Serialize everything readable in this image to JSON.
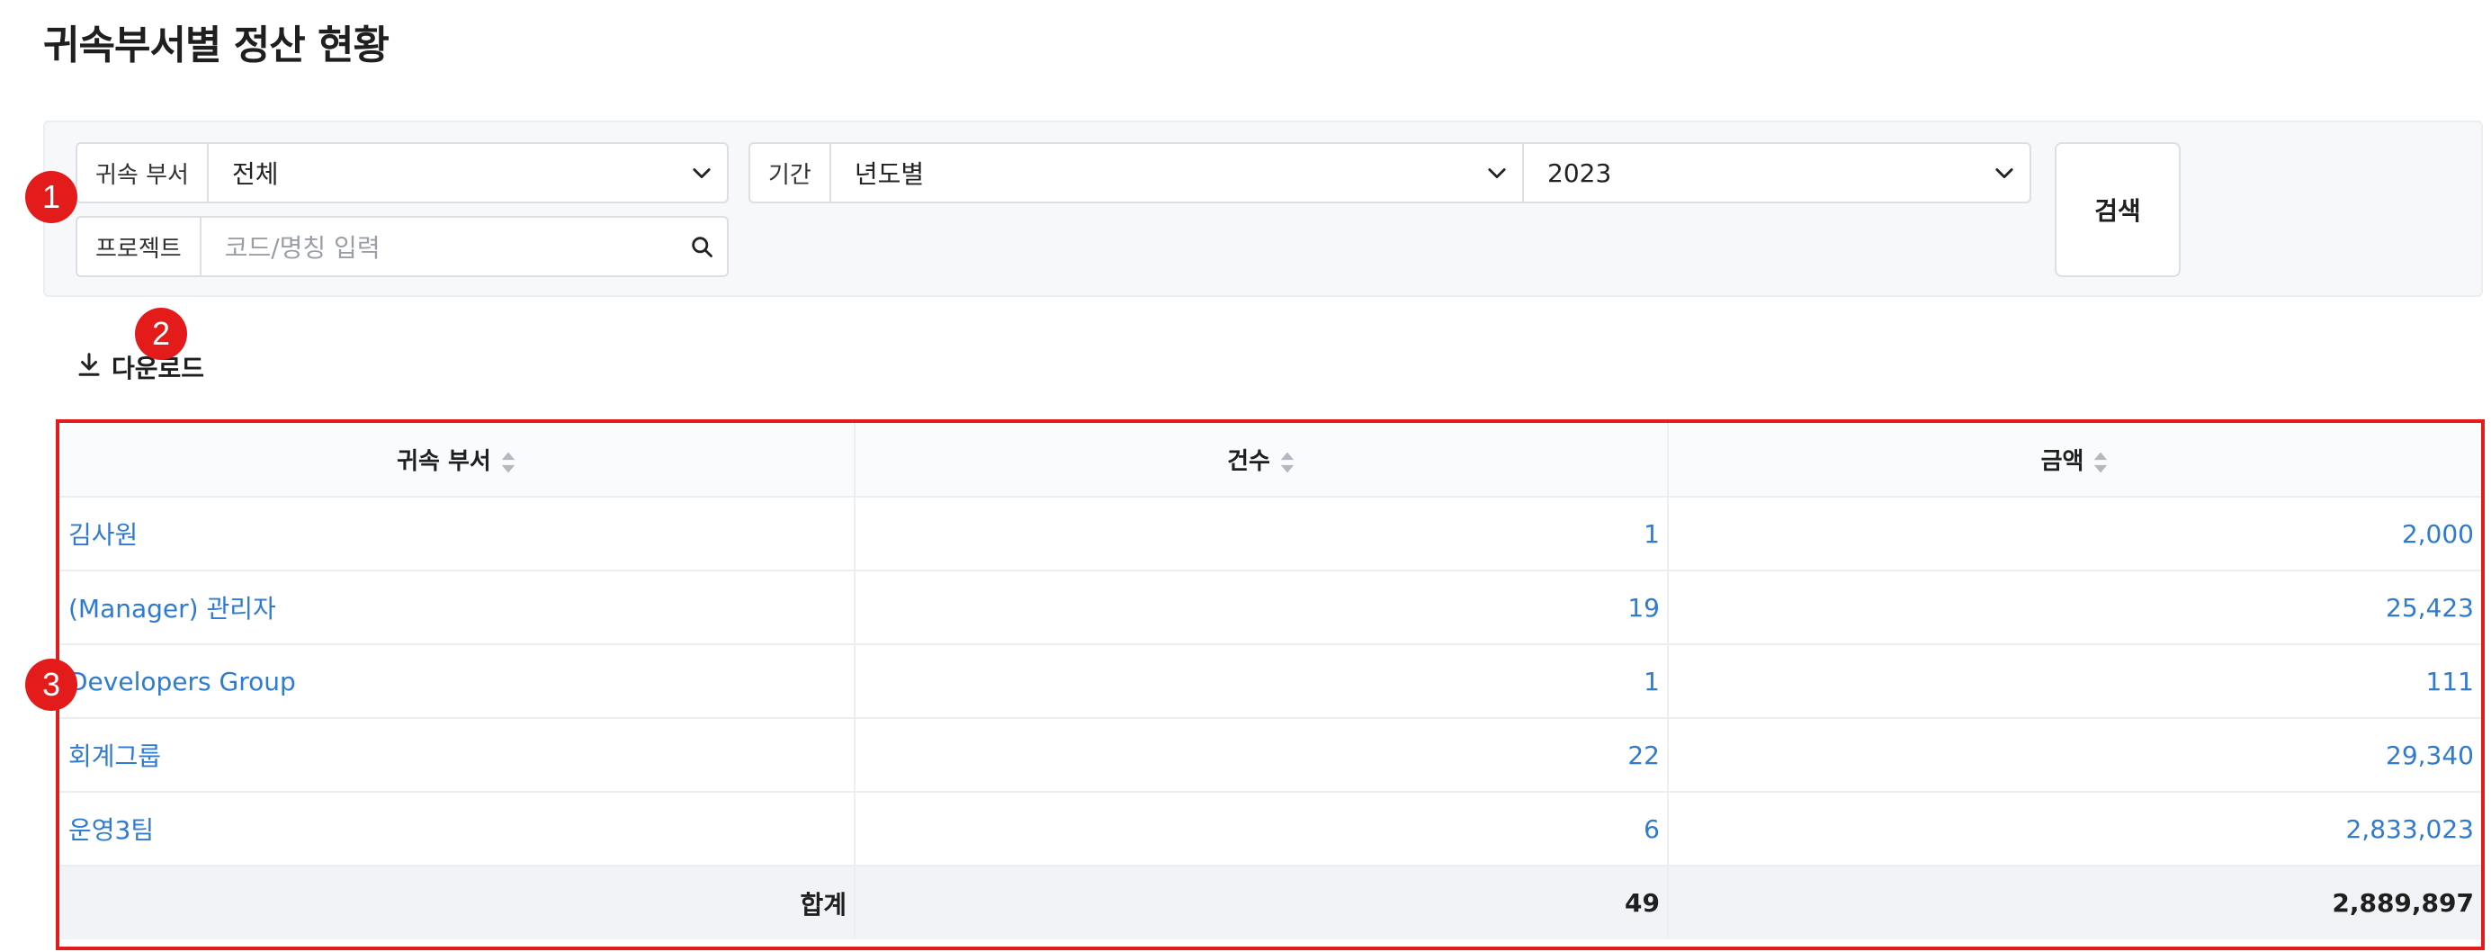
{
  "page": {
    "title": "귀속부서별 정산 현황"
  },
  "filters": {
    "department": {
      "label": "귀속 부서",
      "value": "전체"
    },
    "period": {
      "label": "기간",
      "value": "년도별"
    },
    "year": {
      "value": "2023"
    },
    "project": {
      "label": "프로젝트",
      "placeholder": "코드/명칭 입력"
    },
    "search_label": "검색"
  },
  "toolbar": {
    "download_label": "다운로드"
  },
  "markers": [
    "1",
    "2",
    "3"
  ],
  "table": {
    "columns": [
      "귀속 부서",
      "건수",
      "금액"
    ],
    "rows": [
      {
        "department": "김사원",
        "count": "1",
        "amount": "2,000"
      },
      {
        "department": "(Manager) 관리자",
        "count": "19",
        "amount": "25,423"
      },
      {
        "department": "Developers Group",
        "count": "1",
        "amount": "111"
      },
      {
        "department": "회계그룹",
        "count": "22",
        "amount": "29,340"
      },
      {
        "department": "운영3팀",
        "count": "6",
        "amount": "2,833,023"
      }
    ],
    "total": {
      "label": "합계",
      "count": "49",
      "amount": "2,889,897"
    }
  },
  "colors": {
    "link": "#2e7bd1",
    "marker": "#e31b1b",
    "highlight_border": "#e31b1b"
  }
}
